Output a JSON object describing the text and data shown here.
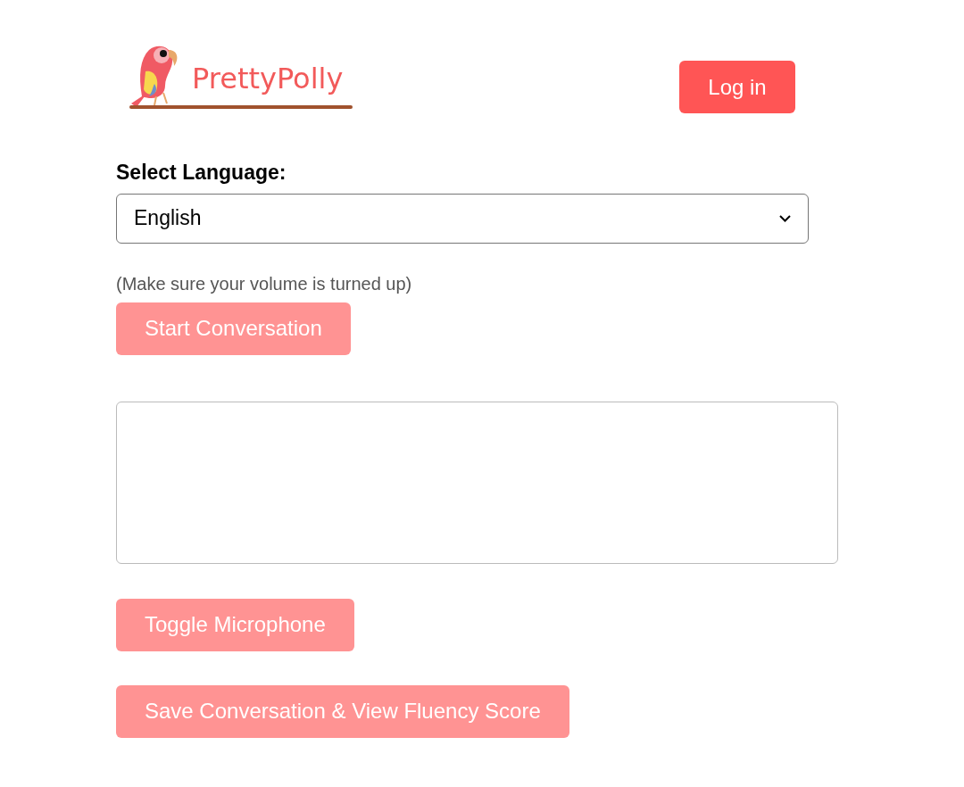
{
  "header": {
    "logo_text": "PrettyPolly",
    "login_button": "Log in"
  },
  "language": {
    "label": "Select Language:",
    "value": "English"
  },
  "note": "(Make sure your volume is turned up)",
  "start_button": {
    "label": "Start Conversation",
    "disabled": true
  },
  "buttons": [
    {
      "label": "Toggle Microphone",
      "disabled": true
    },
    {
      "label": "Save Conversation & View Fluency Score",
      "disabled": true
    }
  ]
}
